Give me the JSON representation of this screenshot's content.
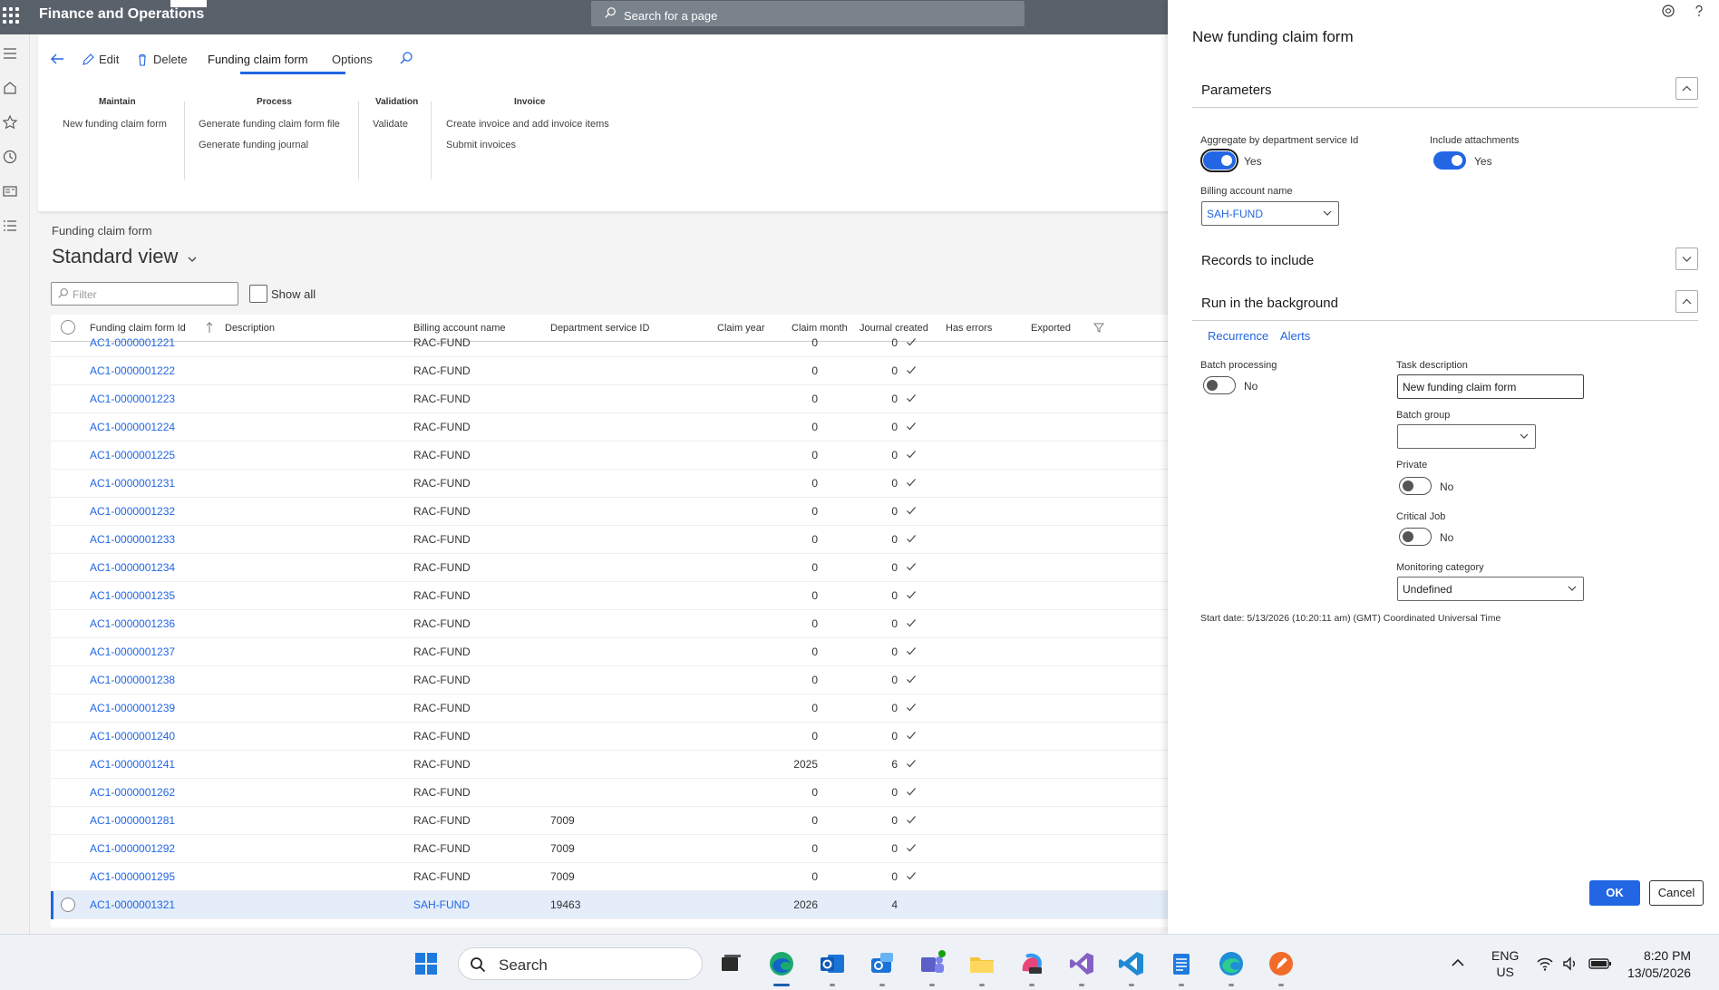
{
  "topbar": {
    "app_title": "Finance and Operations",
    "search_placeholder": "Search for a page"
  },
  "action_pane": {
    "edit": "Edit",
    "delete": "Delete",
    "tab_active": "Funding claim form",
    "tab_options": "Options",
    "groups": {
      "maintain": {
        "title": "Maintain",
        "items": [
          "New funding claim form"
        ]
      },
      "process": {
        "title": "Process",
        "items": [
          "Generate funding claim form file",
          "Generate funding journal"
        ]
      },
      "validation": {
        "title": "Validation",
        "items": [
          "Validate"
        ]
      },
      "invoice": {
        "title": "Invoice",
        "items": [
          "Create invoice and add invoice items",
          "Submit invoices"
        ]
      }
    }
  },
  "content": {
    "breadcrumb": "Funding claim form",
    "view_title": "Standard view",
    "filter_placeholder": "Filter",
    "show_all": "Show all"
  },
  "grid": {
    "columns": [
      "Funding claim form Id",
      "Description",
      "Billing account name",
      "Department service ID",
      "Claim year",
      "Claim month",
      "Journal created",
      "Has errors",
      "Exported"
    ],
    "rows": [
      {
        "id": "AC1-0000001221",
        "billing": "RAC-FUND",
        "dept": "",
        "year": "0",
        "month": "0",
        "journal": true
      },
      {
        "id": "AC1-0000001222",
        "billing": "RAC-FUND",
        "dept": "",
        "year": "0",
        "month": "0",
        "journal": true
      },
      {
        "id": "AC1-0000001223",
        "billing": "RAC-FUND",
        "dept": "",
        "year": "0",
        "month": "0",
        "journal": true
      },
      {
        "id": "AC1-0000001224",
        "billing": "RAC-FUND",
        "dept": "",
        "year": "0",
        "month": "0",
        "journal": true
      },
      {
        "id": "AC1-0000001225",
        "billing": "RAC-FUND",
        "dept": "",
        "year": "0",
        "month": "0",
        "journal": true
      },
      {
        "id": "AC1-0000001231",
        "billing": "RAC-FUND",
        "dept": "",
        "year": "0",
        "month": "0",
        "journal": true
      },
      {
        "id": "AC1-0000001232",
        "billing": "RAC-FUND",
        "dept": "",
        "year": "0",
        "month": "0",
        "journal": true
      },
      {
        "id": "AC1-0000001233",
        "billing": "RAC-FUND",
        "dept": "",
        "year": "0",
        "month": "0",
        "journal": true
      },
      {
        "id": "AC1-0000001234",
        "billing": "RAC-FUND",
        "dept": "",
        "year": "0",
        "month": "0",
        "journal": true
      },
      {
        "id": "AC1-0000001235",
        "billing": "RAC-FUND",
        "dept": "",
        "year": "0",
        "month": "0",
        "journal": true
      },
      {
        "id": "AC1-0000001236",
        "billing": "RAC-FUND",
        "dept": "",
        "year": "0",
        "month": "0",
        "journal": true
      },
      {
        "id": "AC1-0000001237",
        "billing": "RAC-FUND",
        "dept": "",
        "year": "0",
        "month": "0",
        "journal": true
      },
      {
        "id": "AC1-0000001238",
        "billing": "RAC-FUND",
        "dept": "",
        "year": "0",
        "month": "0",
        "journal": true
      },
      {
        "id": "AC1-0000001239",
        "billing": "RAC-FUND",
        "dept": "",
        "year": "0",
        "month": "0",
        "journal": true
      },
      {
        "id": "AC1-0000001240",
        "billing": "RAC-FUND",
        "dept": "",
        "year": "0",
        "month": "0",
        "journal": true
      },
      {
        "id": "AC1-0000001241",
        "billing": "RAC-FUND",
        "dept": "",
        "year": "2025",
        "month": "6",
        "journal": true
      },
      {
        "id": "AC1-0000001262",
        "billing": "RAC-FUND",
        "dept": "",
        "year": "0",
        "month": "0",
        "journal": true
      },
      {
        "id": "AC1-0000001281",
        "billing": "RAC-FUND",
        "dept": "7009",
        "year": "0",
        "month": "0",
        "journal": true
      },
      {
        "id": "AC1-0000001292",
        "billing": "RAC-FUND",
        "dept": "7009",
        "year": "0",
        "month": "0",
        "journal": true
      },
      {
        "id": "AC1-0000001295",
        "billing": "RAC-FUND",
        "dept": "7009",
        "year": "0",
        "month": "0",
        "journal": true
      },
      {
        "id": "AC1-0000001321",
        "billing": "SAH-FUND",
        "dept": "19463",
        "year": "2026",
        "month": "4",
        "journal": false,
        "selected": true
      }
    ]
  },
  "panel": {
    "title": "New funding claim form",
    "parameters_title": "Parameters",
    "aggregate_label": "Aggregate by department service Id",
    "aggregate_value": "Yes",
    "attachments_label": "Include attachments",
    "attachments_value": "Yes",
    "billing_label": "Billing account name",
    "billing_value": "SAH-FUND",
    "records_title": "Records to include",
    "background_title": "Run in the background",
    "subtabs": [
      "Recurrence",
      "Alerts"
    ],
    "batch_label": "Batch processing",
    "batch_value": "No",
    "task_label": "Task description",
    "task_value": "New funding claim form",
    "batch_group_label": "Batch group",
    "batch_group_value": "",
    "private_label": "Private",
    "private_value": "No",
    "critical_label": "Critical Job",
    "critical_value": "No",
    "monitoring_label": "Monitoring category",
    "monitoring_value": "Undefined",
    "start_date": "Start date: 5/13/2026 (10:20:11 am) (GMT) Coordinated Universal Time",
    "ok": "OK",
    "cancel": "Cancel"
  },
  "taskbar": {
    "search": "Search",
    "lang_top": "ENG",
    "lang_bottom": "US",
    "time": "8:20 PM",
    "date": "13/05/2026"
  },
  "colors": {
    "accent": "#2266e3",
    "topbar": "#59616b"
  }
}
